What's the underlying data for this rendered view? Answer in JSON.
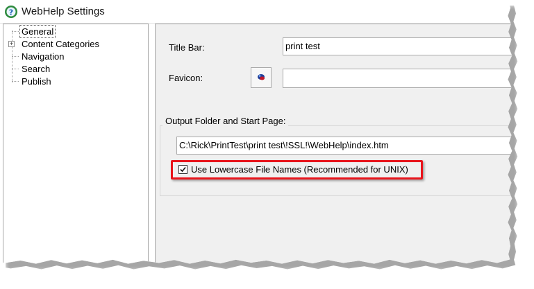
{
  "window": {
    "title": "WebHelp Settings",
    "icon": "webhelp-app-icon"
  },
  "tree": {
    "items": [
      {
        "label": "General",
        "selected": true
      },
      {
        "label": "Content Categories",
        "expandable": true,
        "expander": "+"
      },
      {
        "label": "Navigation"
      },
      {
        "label": "Search"
      },
      {
        "label": "Publish"
      }
    ]
  },
  "general": {
    "title_bar_label": "Title Bar:",
    "title_bar_value": "print test",
    "favicon_label": "Favicon:",
    "favicon_value": "",
    "favicon_icon": "favicon-image-icon",
    "output_group_title": "Output Folder and Start Page:",
    "output_path": "C:\\Rick\\PrintTest\\print test\\!SSL!\\WebHelp\\index.htm",
    "lowercase_label": "Use Lowercase File Names (Recommended for UNIX)",
    "lowercase_checked": true
  },
  "colors": {
    "highlight": "#e8141b",
    "panel_bg": "#f0f0f0"
  }
}
